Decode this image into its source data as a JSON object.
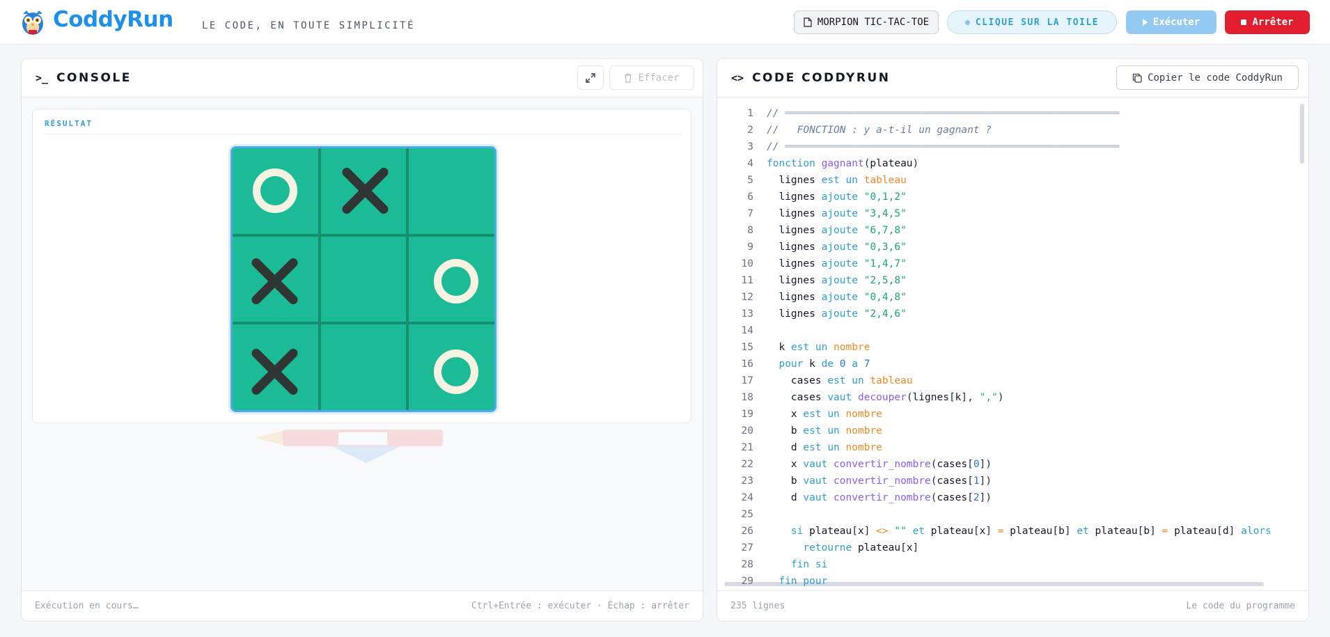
{
  "header": {
    "brand": "CoddyRun",
    "tagline": "LE CODE, EN TOUTE SIMPLICITÉ",
    "project_label": "MORPION TIC-TAC-TOE",
    "hint_label": "CLIQUE SUR LA TOILE",
    "run_label": "Exécuter",
    "stop_label": "Arrêter"
  },
  "console": {
    "title": "CONSOLE",
    "clear_label": "Effacer",
    "result_label": "RÉSULTAT",
    "board": [
      "O",
      "X",
      "",
      "X",
      "",
      "O",
      "X",
      "",
      "O"
    ],
    "status": "Exécution en cours…",
    "shortcuts": "Ctrl+Entrée : exécuter · Échap : arrêter"
  },
  "code": {
    "title": "CODE CODDYRUN",
    "copy_label": "Copier le code CoddyRun",
    "line_count": "235 lignes",
    "footer_right": "Le code du programme",
    "lines": [
      {
        "n": "1",
        "t": "// ═══════════════════════════════════════════════════════"
      },
      {
        "n": "2",
        "t": "//   FONCTION : y a-t-il un gagnant ?"
      },
      {
        "n": "3",
        "t": "// ═══════════════════════════════════════════════════════"
      },
      {
        "n": "4",
        "t": "fonction gagnant(plateau)"
      },
      {
        "n": "5",
        "t": "  lignes est un tableau"
      },
      {
        "n": "6",
        "t": "  lignes ajoute \"0,1,2\""
      },
      {
        "n": "7",
        "t": "  lignes ajoute \"3,4,5\""
      },
      {
        "n": "8",
        "t": "  lignes ajoute \"6,7,8\""
      },
      {
        "n": "9",
        "t": "  lignes ajoute \"0,3,6\""
      },
      {
        "n": "10",
        "t": "  lignes ajoute \"1,4,7\""
      },
      {
        "n": "11",
        "t": "  lignes ajoute \"2,5,8\""
      },
      {
        "n": "12",
        "t": "  lignes ajoute \"0,4,8\""
      },
      {
        "n": "13",
        "t": "  lignes ajoute \"2,4,6\""
      },
      {
        "n": "14",
        "t": ""
      },
      {
        "n": "15",
        "t": "  k est un nombre"
      },
      {
        "n": "16",
        "t": "  pour k de 0 a 7"
      },
      {
        "n": "17",
        "t": "    cases est un tableau"
      },
      {
        "n": "18",
        "t": "    cases vaut decouper(lignes[k], \",\")"
      },
      {
        "n": "19",
        "t": "    x est un nombre"
      },
      {
        "n": "20",
        "t": "    b est un nombre"
      },
      {
        "n": "21",
        "t": "    d est un nombre"
      },
      {
        "n": "22",
        "t": "    x vaut convertir_nombre(cases[0])"
      },
      {
        "n": "23",
        "t": "    b vaut convertir_nombre(cases[1])"
      },
      {
        "n": "24",
        "t": "    d vaut convertir_nombre(cases[2])"
      },
      {
        "n": "25",
        "t": ""
      },
      {
        "n": "26",
        "t": "    si plateau[x] <> \"\" et plateau[x] = plateau[b] et plateau[b] = plateau[d] alors"
      },
      {
        "n": "27",
        "t": "      retourne plateau[x]"
      },
      {
        "n": "28",
        "t": "    fin si"
      },
      {
        "n": "29",
        "t": "  fin pour"
      }
    ]
  },
  "colors": {
    "brand": "#1e90ea",
    "board": "#1cbb98",
    "stop": "#e11d2e",
    "run": "#93c9f3"
  }
}
